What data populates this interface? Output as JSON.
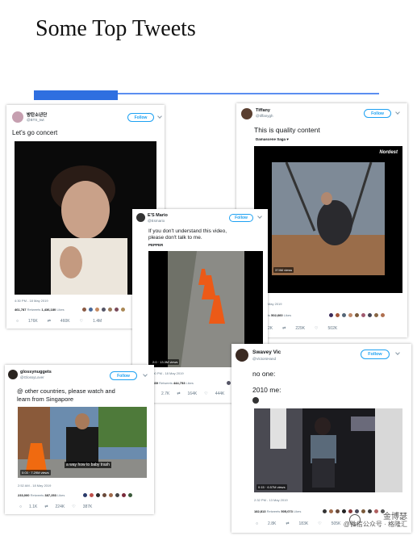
{
  "slide": {
    "title": "Some Top Tweets"
  },
  "tweets": [
    {
      "id": "bts",
      "name": "방탄소년단",
      "handle": "@BTS_twt",
      "follow_label": "Follow",
      "text": "Let's go concert",
      "timestamp": "4:30 PM - 18 May 2019",
      "retweets": "461,787",
      "retweets_label": "Retweets",
      "likes": "1,436,180",
      "likes_label": "Likes",
      "replies": "176K",
      "rt_count": "460K",
      "like_count": "1.4M"
    },
    {
      "id": "tiffany",
      "name": "Tiffany",
      "handle": "@tiffanygh",
      "follow_label": "Follow",
      "text": "This is quality content",
      "quoted": "Damascene Saga ♥",
      "media_label": "Nordest",
      "video_views": "374M views",
      "timestamp": "9:14 - 17 May 2019",
      "retweets": "5",
      "retweets_label": "Retweets",
      "likes": "502,660",
      "likes_label": "Likes",
      "replies": "2K",
      "rt_count": "229K",
      "like_count": "502K"
    },
    {
      "id": "esmario",
      "name": "E'S Mario",
      "handle": "@Esmario",
      "follow_label": "Follow",
      "text_line1": "If you don't understand this video,",
      "text_line2": "please don't talk to me.",
      "quoted": "PEPPER",
      "video_views": "2:0 · 13.3M views",
      "timestamp": "3:00 PM - 18 May 2019",
      "retweets": "4,539",
      "retweets_label": "Retweets",
      "likes": "444,753",
      "likes_label": "Likes",
      "replies": "2.7K",
      "rt_count": "164K",
      "like_count": "444K"
    },
    {
      "id": "glossy",
      "name": "glossynuggets",
      "handle": "@GlossyLover",
      "follow_label": "Follow",
      "text_line1": "@ other countries, please watch and",
      "text_line2": "learn from Singapore",
      "video_views": "0:03 · 7.29M views",
      "caption": "a way how to baby trash",
      "timestamp": "2:52 AM - 18 May 2019",
      "retweets": "233,000",
      "retweets_label": "Retweets",
      "likes": "387,253",
      "likes_label": "Likes",
      "replies": "1.1K",
      "rt_count": "224K",
      "like_count": "387K"
    },
    {
      "id": "swavey",
      "name": "Swavey Vic",
      "handle": "@VictorsHand",
      "follow_label": "Follow",
      "text_line1": "no one:",
      "text_line2": "2010 me:",
      "video_views": "0:15 · 6.57M views",
      "timestamp": "2:32 PM - 13 May 2019",
      "retweets": "182,813",
      "retweets_label": "Retweets",
      "likes": "505,073",
      "likes_label": "Likes",
      "replies": "2.8K",
      "rt_count": "183K",
      "like_count": "505K"
    }
  ],
  "watermark": {
    "line1": "金博瑟",
    "line2": "@微信公众号 · 格隆汇"
  },
  "colors": {
    "accent_blue": "#2f6fe0",
    "twitter_blue": "#1da1f2"
  }
}
